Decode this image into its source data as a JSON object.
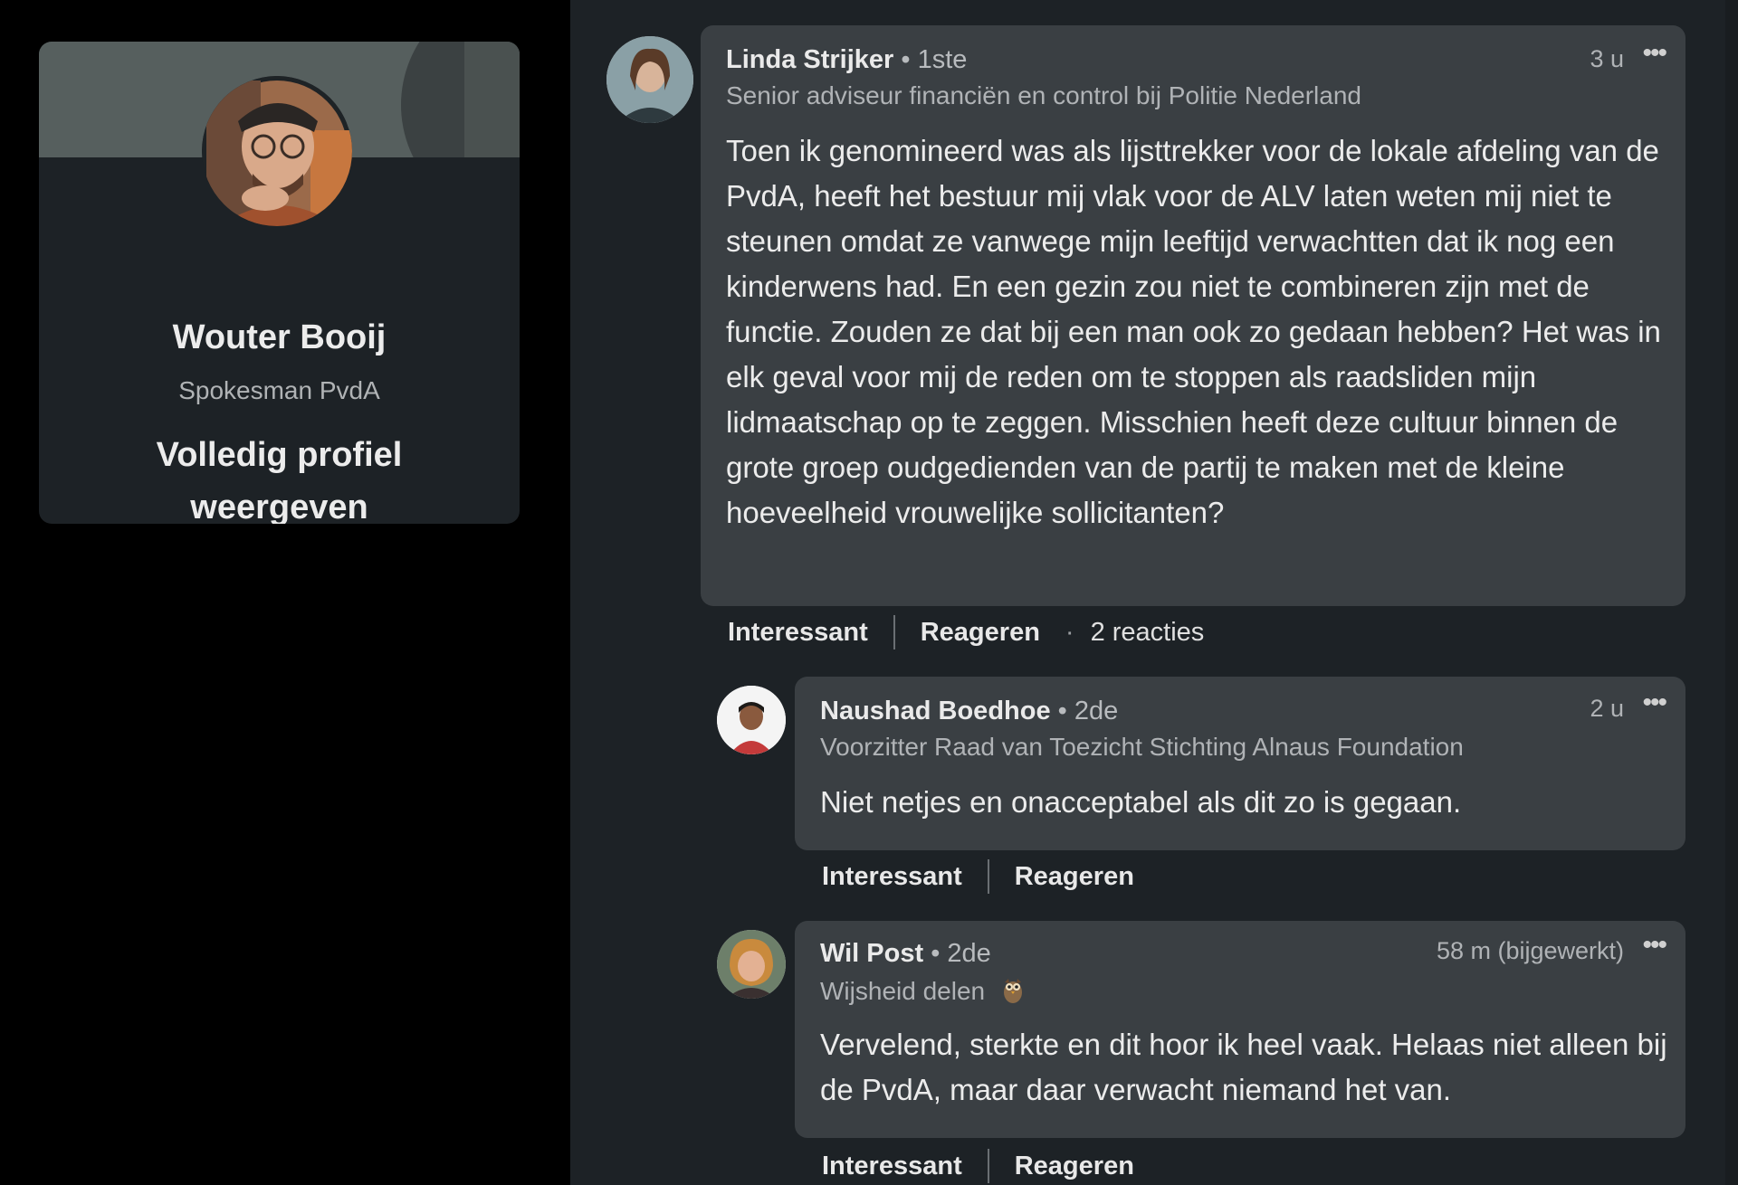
{
  "profile": {
    "name": "Wouter Booij",
    "headline": "Spokesman PvdA",
    "view_profile_label": "Volledig profiel weergeven"
  },
  "comments": [
    {
      "author": "Linda Strijker",
      "degree": "• 1ste",
      "subtitle": "Senior adviseur financiën en control bij Politie Nederland",
      "time": "3 u",
      "text": "Toen ik genomineerd was als lijsttrekker voor de lokale afdeling van de PvdA, heeft het bestuur mij vlak voor de ALV laten weten mij niet te steunen omdat ze vanwege mijn leeftijd verwachtten dat ik nog een kinderwens had. En een gezin zou niet te combineren zijn met de functie. Zouden ze dat bij een man ook zo gedaan hebben? Het was in elk geval voor mij de reden om te stoppen als raadsliden mijn lidmaatschap op te zeggen. Misschien heeft deze cultuur binnen de grote groep oudgedienden van de partij te maken met de kleine hoeveelheid vrouwelijke sollicitanten?",
      "like_label": "Interessant",
      "reply_label": "Reageren",
      "reply_count": "2 reacties"
    },
    {
      "author": "Naushad Boedhoe",
      "degree": "• 2de",
      "subtitle": "Voorzitter Raad van Toezicht Stichting Alnaus Foundation",
      "time": "2 u",
      "text": "Niet netjes en onacceptabel als dit zo is gegaan.",
      "like_label": "Interessant",
      "reply_label": "Reageren"
    },
    {
      "author": "Wil Post",
      "degree": "• 2de",
      "subtitle": "Wijsheid delen",
      "subtitle_emoji": "owl-icon",
      "time": "58 m (bijgewerkt)",
      "text": "Vervelend, sterkte en dit hoor ik heel vaak. Helaas niet alleen bij de PvdA, maar daar verwacht niemand het van.",
      "like_label": "Interessant",
      "reply_label": "Reageren"
    }
  ],
  "more_icon": "•••",
  "colors": {
    "page_bg": "#000000",
    "card_bg": "#1d2226",
    "bubble_bg": "#3a3f43",
    "banner": "#565f5e"
  }
}
